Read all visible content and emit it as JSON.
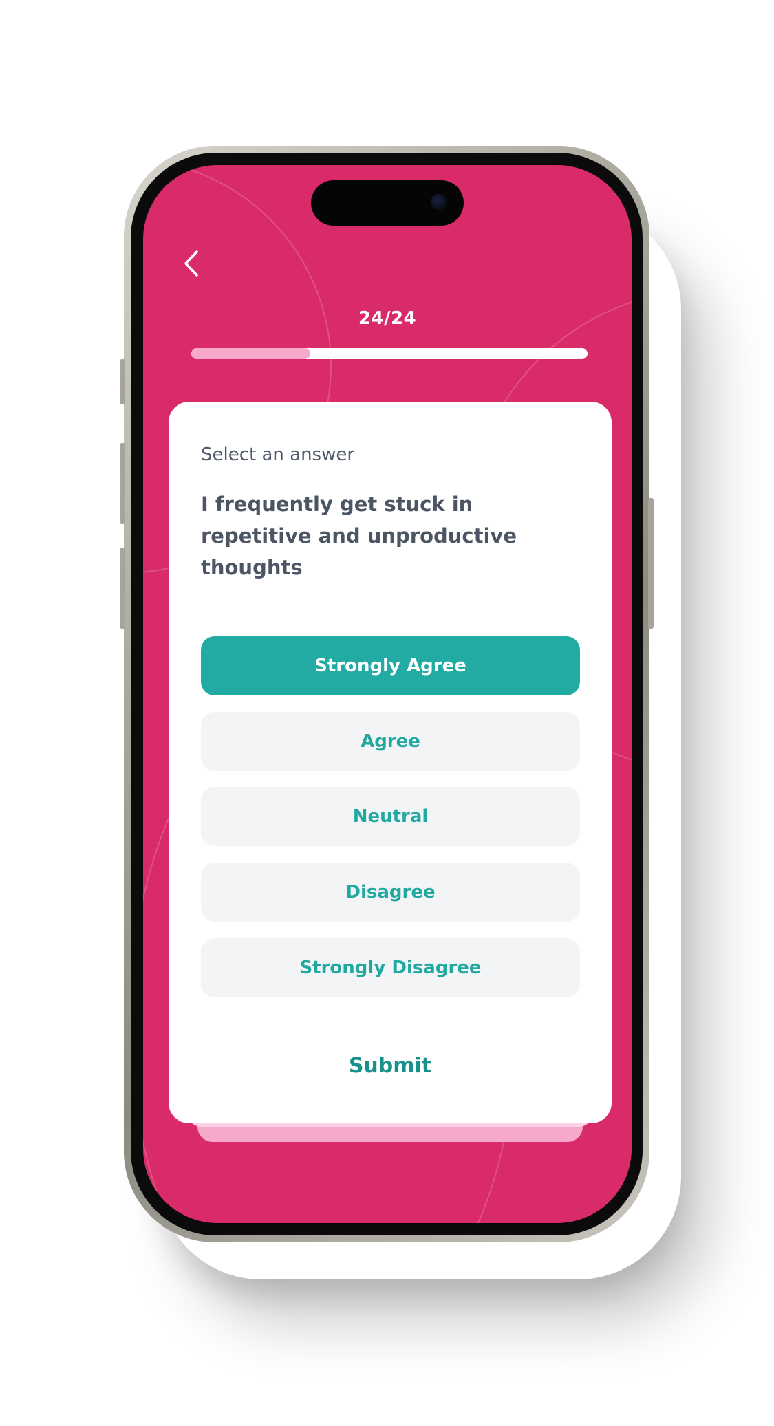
{
  "colors": {
    "screen_background": "#d92b69",
    "accent_teal": "#21aba3",
    "progress_fill": "#f7a9cb",
    "card_background": "#ffffff",
    "option_background": "#f3f4f6"
  },
  "header": {
    "back_icon": "chevron-left-icon",
    "progress_text": "24/24",
    "progress_fraction": 0.3
  },
  "question_card": {
    "hint": "Select an answer",
    "question": "I frequently get stuck in repetitive and unproductive thoughts",
    "selected_index": 0,
    "options": [
      {
        "label": "Strongly Agree"
      },
      {
        "label": "Agree"
      },
      {
        "label": "Neutral"
      },
      {
        "label": "Disagree"
      },
      {
        "label": "Strongly Disagree"
      }
    ],
    "submit_label": "Submit"
  }
}
